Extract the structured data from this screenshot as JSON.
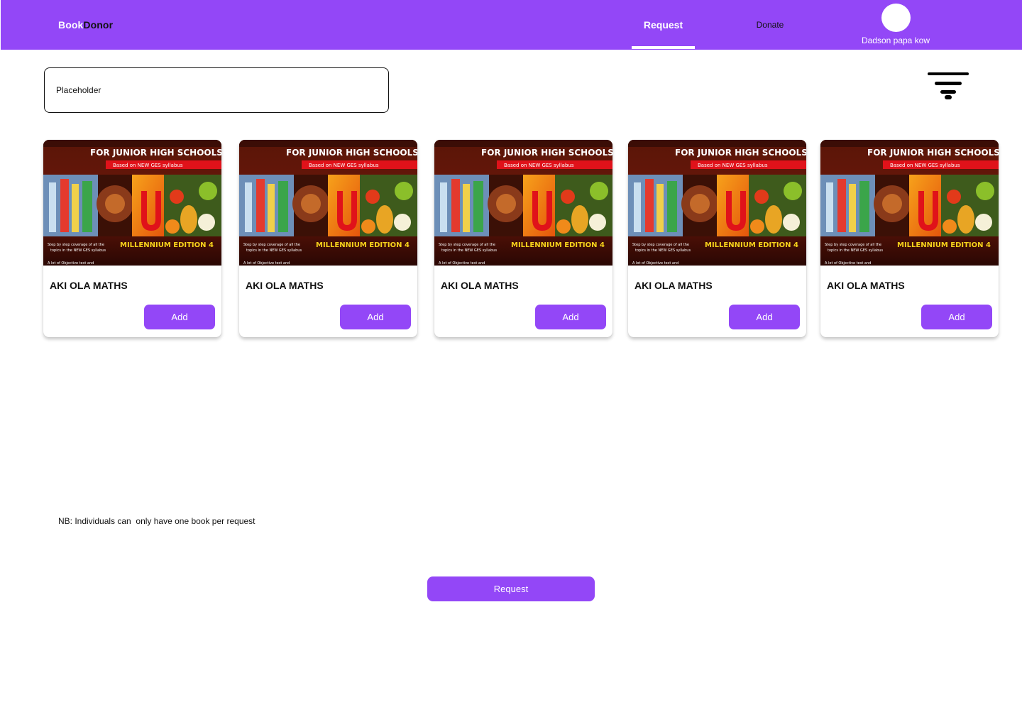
{
  "header": {
    "brand_part1": "Book",
    "brand_part2": "Donor",
    "nav": {
      "request_label": "Request",
      "donate_label": "Donate"
    },
    "user": {
      "name": "Dadson papa kow"
    }
  },
  "search": {
    "placeholder": "Placeholder"
  },
  "filter_icon": "filter-icon",
  "cover_text": {
    "line1": "FOR JUNIOR HIGH SCHOOLS",
    "line2": "Based on NEW GES syllabus",
    "edition": "MILLENNIUM EDITION 4",
    "bullet1a": "Step by step coverage of all the",
    "bullet1b": "topics in the NEW GES syllabus",
    "bullet2": "A lot of Objective test and"
  },
  "books": [
    {
      "title": "AKI OLA MATHS",
      "button_label": "Add"
    },
    {
      "title": "AKI OLA MATHS",
      "button_label": "Add"
    },
    {
      "title": "AKI OLA MATHS",
      "button_label": "Add"
    },
    {
      "title": "AKI OLA MATHS",
      "button_label": "Add"
    },
    {
      "title": "AKI OLA MATHS",
      "button_label": "Add"
    }
  ],
  "note": "NB: Individuals can  only have one book per request",
  "request_button_label": "Request",
  "colors": {
    "accent": "#9347f7",
    "surface": "#ffffff"
  }
}
